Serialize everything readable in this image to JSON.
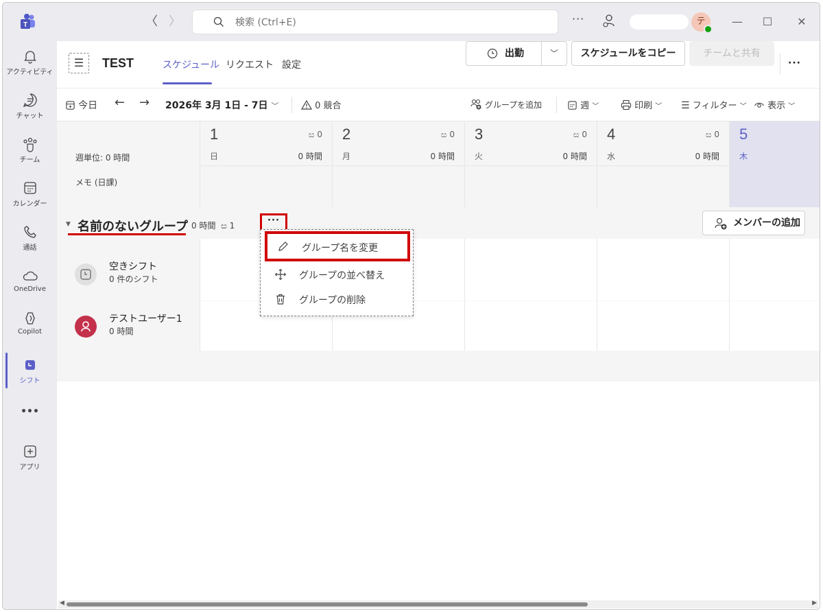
{
  "titlebar": {
    "search_placeholder": "検索 (Ctrl+E)",
    "more": "···",
    "avatar_initial": "テ",
    "nav_back": "〈",
    "nav_forward": "〉",
    "minimize": "—",
    "maximize": "☐",
    "close": "✕"
  },
  "rail": {
    "items": [
      {
        "label": "アクティビティ",
        "icon": "bell-icon"
      },
      {
        "label": "チャット",
        "icon": "chat-icon"
      },
      {
        "label": "チーム",
        "icon": "teams-icon"
      },
      {
        "label": "カレンダー",
        "icon": "calendar-icon"
      },
      {
        "label": "通話",
        "icon": "phone-icon"
      },
      {
        "label": "OneDrive",
        "icon": "cloud-icon"
      },
      {
        "label": "Copilot",
        "icon": "copilot-icon"
      },
      {
        "label": "シフト",
        "icon": "shifts-icon"
      },
      {
        "label": "•••",
        "icon": "more-icon"
      },
      {
        "label": "アプリ",
        "icon": "apps-icon"
      }
    ],
    "active": "シフト"
  },
  "header": {
    "team_name": "TEST",
    "tabs": [
      "スケジュール",
      "リクエスト",
      "設定"
    ],
    "active_tab": "スケジュール",
    "clock_in_label": "出勤",
    "copy_schedule_label": "スケジュールをコピー",
    "share_label": "チームと共有",
    "more": "···"
  },
  "toolbar": {
    "today_label": "今日",
    "date_range": "2026年 3月 1日 - 7日",
    "conflicts": "0 競合",
    "add_group": "グループを追加",
    "view_week": "週",
    "print": "印刷",
    "filter": "フィルター",
    "display": "表示"
  },
  "grid": {
    "week_total": "週単位: 0 時間",
    "memo_label": "メモ (日課)",
    "days": [
      {
        "num": "1",
        "weekday": "日",
        "people": "0",
        "hours": "0 時間"
      },
      {
        "num": "2",
        "weekday": "月",
        "people": "0",
        "hours": "0 時間"
      },
      {
        "num": "3",
        "weekday": "火",
        "people": "0",
        "hours": "0 時間"
      },
      {
        "num": "4",
        "weekday": "水",
        "people": "0",
        "hours": "0 時間"
      },
      {
        "num": "5",
        "weekday": "木",
        "people": "",
        "hours": ""
      }
    ]
  },
  "group": {
    "name": "名前のないグループ",
    "hours": "0 時間",
    "members_count": "1",
    "more": "···",
    "add_member_label": "メンバーの追加"
  },
  "members": [
    {
      "name": "空きシフト",
      "sub": "0 件のシフト",
      "icon": "open-shift-icon"
    },
    {
      "name": "テストユーザー1",
      "sub": "0 時間",
      "icon": "user-avatar-icon"
    }
  ],
  "context_menu": {
    "items": [
      {
        "label": "グループ名を変更",
        "icon": "pencil-icon"
      },
      {
        "label": "グループの並べ替え",
        "icon": "move-icon"
      },
      {
        "label": "グループの削除",
        "icon": "trash-icon"
      }
    ],
    "highlighted": "グループ名を変更"
  },
  "colors": {
    "accent": "#5b5fc7",
    "highlight_red": "#d00000",
    "rail_bg": "#ebebf0",
    "presence_green": "#13a10e",
    "user_avatar_red": "#c4314b"
  }
}
